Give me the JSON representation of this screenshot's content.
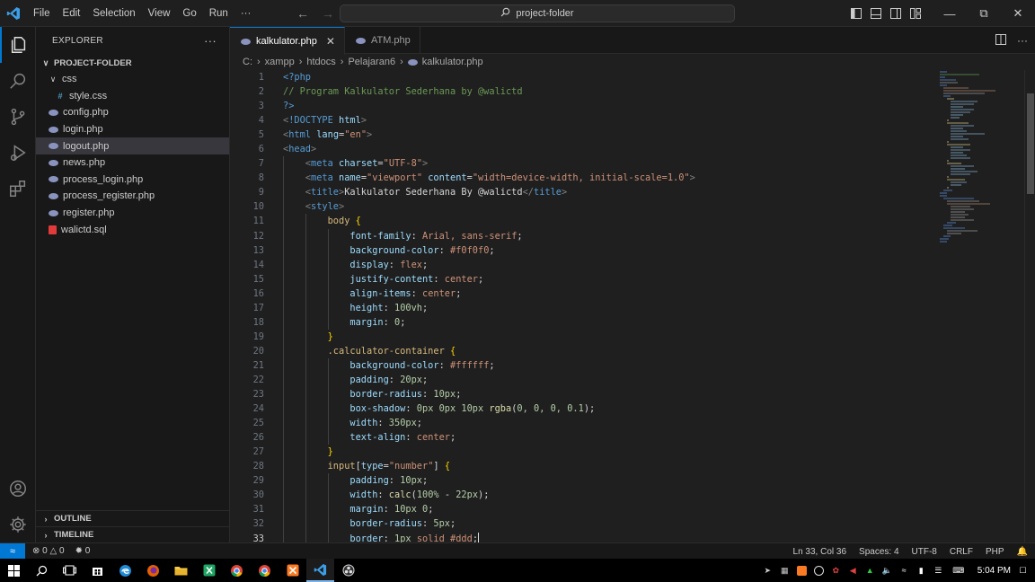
{
  "menu": [
    "File",
    "Edit",
    "Selection",
    "View",
    "Go",
    "Run",
    "···"
  ],
  "command_center": "project-folder",
  "sidebar": {
    "title": "EXPLORER",
    "more": "···",
    "root": "PROJECT-FOLDER",
    "items": [
      {
        "label": "css",
        "type": "folder",
        "indent": 1,
        "selected": false
      },
      {
        "label": "style.css",
        "type": "css",
        "indent": 2,
        "selected": false
      },
      {
        "label": "config.php",
        "type": "php",
        "indent": 1,
        "selected": false
      },
      {
        "label": "login.php",
        "type": "php",
        "indent": 1,
        "selected": false
      },
      {
        "label": "logout.php",
        "type": "php",
        "indent": 1,
        "selected": true
      },
      {
        "label": "news.php",
        "type": "php",
        "indent": 1,
        "selected": false
      },
      {
        "label": "process_login.php",
        "type": "php",
        "indent": 1,
        "selected": false
      },
      {
        "label": "process_register.php",
        "type": "php",
        "indent": 1,
        "selected": false
      },
      {
        "label": "register.php",
        "type": "php",
        "indent": 1,
        "selected": false
      },
      {
        "label": "walictd.sql",
        "type": "sql",
        "indent": 1,
        "selected": false
      }
    ],
    "outline": "OUTLINE",
    "timeline": "TIMELINE"
  },
  "tabs": [
    {
      "label": "kalkulator.php",
      "active": true
    },
    {
      "label": "ATM.php",
      "active": false
    }
  ],
  "breadcrumb": [
    "C:",
    "xampp",
    "htdocs",
    "Pelajaran6",
    "kalkulator.php"
  ],
  "code": {
    "current_line": 33,
    "lines": [
      {
        "n": 1,
        "indent": 0,
        "tokens": [
          [
            "t-php",
            "<?php"
          ]
        ]
      },
      {
        "n": 2,
        "indent": 0,
        "tokens": [
          [
            "t-cmt",
            "// Program Kalkulator Sederhana by @walictd"
          ]
        ]
      },
      {
        "n": 3,
        "indent": 0,
        "tokens": [
          [
            "t-php",
            "?>"
          ]
        ]
      },
      {
        "n": 4,
        "indent": 0,
        "tokens": [
          [
            "t-punc",
            "<"
          ],
          [
            "t-tag",
            "!DOCTYPE"
          ],
          [
            "t-txt",
            " "
          ],
          [
            "t-attr",
            "html"
          ],
          [
            "t-punc",
            ">"
          ]
        ]
      },
      {
        "n": 5,
        "indent": 0,
        "tokens": [
          [
            "t-punc",
            "<"
          ],
          [
            "t-tag",
            "html"
          ],
          [
            "t-txt",
            " "
          ],
          [
            "t-attr",
            "lang"
          ],
          [
            "t-txt",
            "="
          ],
          [
            "t-str",
            "\"en\""
          ],
          [
            "t-punc",
            ">"
          ]
        ]
      },
      {
        "n": 6,
        "indent": 0,
        "tokens": [
          [
            "t-punc",
            "<"
          ],
          [
            "t-tag",
            "head"
          ],
          [
            "t-punc",
            ">"
          ]
        ]
      },
      {
        "n": 7,
        "indent": 1,
        "tokens": [
          [
            "t-punc",
            "<"
          ],
          [
            "t-tag",
            "meta"
          ],
          [
            "t-txt",
            " "
          ],
          [
            "t-attr",
            "charset"
          ],
          [
            "t-txt",
            "="
          ],
          [
            "t-str",
            "\"UTF-8\""
          ],
          [
            "t-punc",
            ">"
          ]
        ]
      },
      {
        "n": 8,
        "indent": 1,
        "tokens": [
          [
            "t-punc",
            "<"
          ],
          [
            "t-tag",
            "meta"
          ],
          [
            "t-txt",
            " "
          ],
          [
            "t-attr",
            "name"
          ],
          [
            "t-txt",
            "="
          ],
          [
            "t-str",
            "\"viewport\""
          ],
          [
            "t-txt",
            " "
          ],
          [
            "t-attr",
            "content"
          ],
          [
            "t-txt",
            "="
          ],
          [
            "t-str",
            "\"width=device-width, initial-scale=1.0\""
          ],
          [
            "t-punc",
            ">"
          ]
        ]
      },
      {
        "n": 9,
        "indent": 1,
        "tokens": [
          [
            "t-punc",
            "<"
          ],
          [
            "t-tag",
            "title"
          ],
          [
            "t-punc",
            ">"
          ],
          [
            "t-txt",
            "Kalkulator Sederhana By @walictd"
          ],
          [
            "t-punc",
            "</"
          ],
          [
            "t-tag",
            "title"
          ],
          [
            "t-punc",
            ">"
          ]
        ]
      },
      {
        "n": 10,
        "indent": 1,
        "tokens": [
          [
            "t-punc",
            "<"
          ],
          [
            "t-tag",
            "style"
          ],
          [
            "t-punc",
            ">"
          ]
        ]
      },
      {
        "n": 11,
        "indent": 2,
        "tokens": [
          [
            "t-sel",
            "body"
          ],
          [
            "t-txt",
            " "
          ],
          [
            "t-brace",
            "{"
          ]
        ]
      },
      {
        "n": 12,
        "indent": 3,
        "tokens": [
          [
            "t-prop",
            "font-family"
          ],
          [
            "t-txt",
            ": "
          ],
          [
            "t-str",
            "Arial, sans-serif"
          ],
          [
            "t-txt",
            ";"
          ]
        ]
      },
      {
        "n": 13,
        "indent": 3,
        "tokens": [
          [
            "t-prop",
            "background-color"
          ],
          [
            "t-txt",
            ": "
          ],
          [
            "t-str",
            "#f0f0f0"
          ],
          [
            "t-txt",
            ";"
          ]
        ]
      },
      {
        "n": 14,
        "indent": 3,
        "tokens": [
          [
            "t-prop",
            "display"
          ],
          [
            "t-txt",
            ": "
          ],
          [
            "t-str",
            "flex"
          ],
          [
            "t-txt",
            ";"
          ]
        ]
      },
      {
        "n": 15,
        "indent": 3,
        "tokens": [
          [
            "t-prop",
            "justify-content"
          ],
          [
            "t-txt",
            ": "
          ],
          [
            "t-str",
            "center"
          ],
          [
            "t-txt",
            ";"
          ]
        ]
      },
      {
        "n": 16,
        "indent": 3,
        "tokens": [
          [
            "t-prop",
            "align-items"
          ],
          [
            "t-txt",
            ": "
          ],
          [
            "t-str",
            "center"
          ],
          [
            "t-txt",
            ";"
          ]
        ]
      },
      {
        "n": 17,
        "indent": 3,
        "tokens": [
          [
            "t-prop",
            "height"
          ],
          [
            "t-txt",
            ": "
          ],
          [
            "t-num",
            "100vh"
          ],
          [
            "t-txt",
            ";"
          ]
        ]
      },
      {
        "n": 18,
        "indent": 3,
        "tokens": [
          [
            "t-prop",
            "margin"
          ],
          [
            "t-txt",
            ": "
          ],
          [
            "t-num",
            "0"
          ],
          [
            "t-txt",
            ";"
          ]
        ]
      },
      {
        "n": 19,
        "indent": 2,
        "tokens": [
          [
            "t-brace",
            "}"
          ]
        ]
      },
      {
        "n": 20,
        "indent": 2,
        "tokens": [
          [
            "t-sel",
            ".calculator-container"
          ],
          [
            "t-txt",
            " "
          ],
          [
            "t-brace",
            "{"
          ]
        ]
      },
      {
        "n": 21,
        "indent": 3,
        "tokens": [
          [
            "t-prop",
            "background-color"
          ],
          [
            "t-txt",
            ": "
          ],
          [
            "t-str",
            "#ffffff"
          ],
          [
            "t-txt",
            ";"
          ]
        ]
      },
      {
        "n": 22,
        "indent": 3,
        "tokens": [
          [
            "t-prop",
            "padding"
          ],
          [
            "t-txt",
            ": "
          ],
          [
            "t-num",
            "20px"
          ],
          [
            "t-txt",
            ";"
          ]
        ]
      },
      {
        "n": 23,
        "indent": 3,
        "tokens": [
          [
            "t-prop",
            "border-radius"
          ],
          [
            "t-txt",
            ": "
          ],
          [
            "t-num",
            "10px"
          ],
          [
            "t-txt",
            ";"
          ]
        ]
      },
      {
        "n": 24,
        "indent": 3,
        "tokens": [
          [
            "t-prop",
            "box-shadow"
          ],
          [
            "t-txt",
            ": "
          ],
          [
            "t-num",
            "0px 0px 10px "
          ],
          [
            "t-fn",
            "rgba"
          ],
          [
            "t-txt",
            "("
          ],
          [
            "t-num",
            "0, 0, 0, 0.1"
          ],
          [
            "t-txt",
            ");"
          ]
        ]
      },
      {
        "n": 25,
        "indent": 3,
        "tokens": [
          [
            "t-prop",
            "width"
          ],
          [
            "t-txt",
            ": "
          ],
          [
            "t-num",
            "350px"
          ],
          [
            "t-txt",
            ";"
          ]
        ]
      },
      {
        "n": 26,
        "indent": 3,
        "tokens": [
          [
            "t-prop",
            "text-align"
          ],
          [
            "t-txt",
            ": "
          ],
          [
            "t-str",
            "center"
          ],
          [
            "t-txt",
            ";"
          ]
        ]
      },
      {
        "n": 27,
        "indent": 2,
        "tokens": [
          [
            "t-brace",
            "}"
          ]
        ]
      },
      {
        "n": 28,
        "indent": 2,
        "tokens": [
          [
            "t-sel",
            "input"
          ],
          [
            "t-txt",
            "["
          ],
          [
            "t-attr",
            "type"
          ],
          [
            "t-txt",
            "="
          ],
          [
            "t-str",
            "\"number\""
          ],
          [
            "t-txt",
            "] "
          ],
          [
            "t-brace",
            "{"
          ]
        ]
      },
      {
        "n": 29,
        "indent": 3,
        "tokens": [
          [
            "t-prop",
            "padding"
          ],
          [
            "t-txt",
            ": "
          ],
          [
            "t-num",
            "10px"
          ],
          [
            "t-txt",
            ";"
          ]
        ]
      },
      {
        "n": 30,
        "indent": 3,
        "tokens": [
          [
            "t-prop",
            "width"
          ],
          [
            "t-txt",
            ": "
          ],
          [
            "t-fn",
            "calc"
          ],
          [
            "t-txt",
            "("
          ],
          [
            "t-num",
            "100%"
          ],
          [
            "t-txt",
            " - "
          ],
          [
            "t-num",
            "22px"
          ],
          [
            "t-txt",
            ");"
          ]
        ]
      },
      {
        "n": 31,
        "indent": 3,
        "tokens": [
          [
            "t-prop",
            "margin"
          ],
          [
            "t-txt",
            ": "
          ],
          [
            "t-num",
            "10px 0"
          ],
          [
            "t-txt",
            ";"
          ]
        ]
      },
      {
        "n": 32,
        "indent": 3,
        "tokens": [
          [
            "t-prop",
            "border-radius"
          ],
          [
            "t-txt",
            ": "
          ],
          [
            "t-num",
            "5px"
          ],
          [
            "t-txt",
            ";"
          ]
        ]
      },
      {
        "n": 33,
        "indent": 3,
        "tokens": [
          [
            "t-prop",
            "border"
          ],
          [
            "t-txt",
            ": "
          ],
          [
            "t-num",
            "1px "
          ],
          [
            "t-str",
            "solid"
          ],
          [
            "t-txt",
            " "
          ],
          [
            "t-str",
            "#ddd"
          ],
          [
            "t-txt",
            ";"
          ]
        ]
      }
    ]
  },
  "status": {
    "errors": "0",
    "warnings": "0",
    "ports": "0",
    "position": "Ln 33, Col 36",
    "spaces": "Spaces: 4",
    "encoding": "UTF-8",
    "eol": "CRLF",
    "language": "PHP"
  },
  "taskbar": {
    "clock": "5:04 PM"
  },
  "colors": {
    "accent": "#0078d4",
    "editor_bg": "#1f1f1f",
    "sidebar_bg": "#181818"
  }
}
